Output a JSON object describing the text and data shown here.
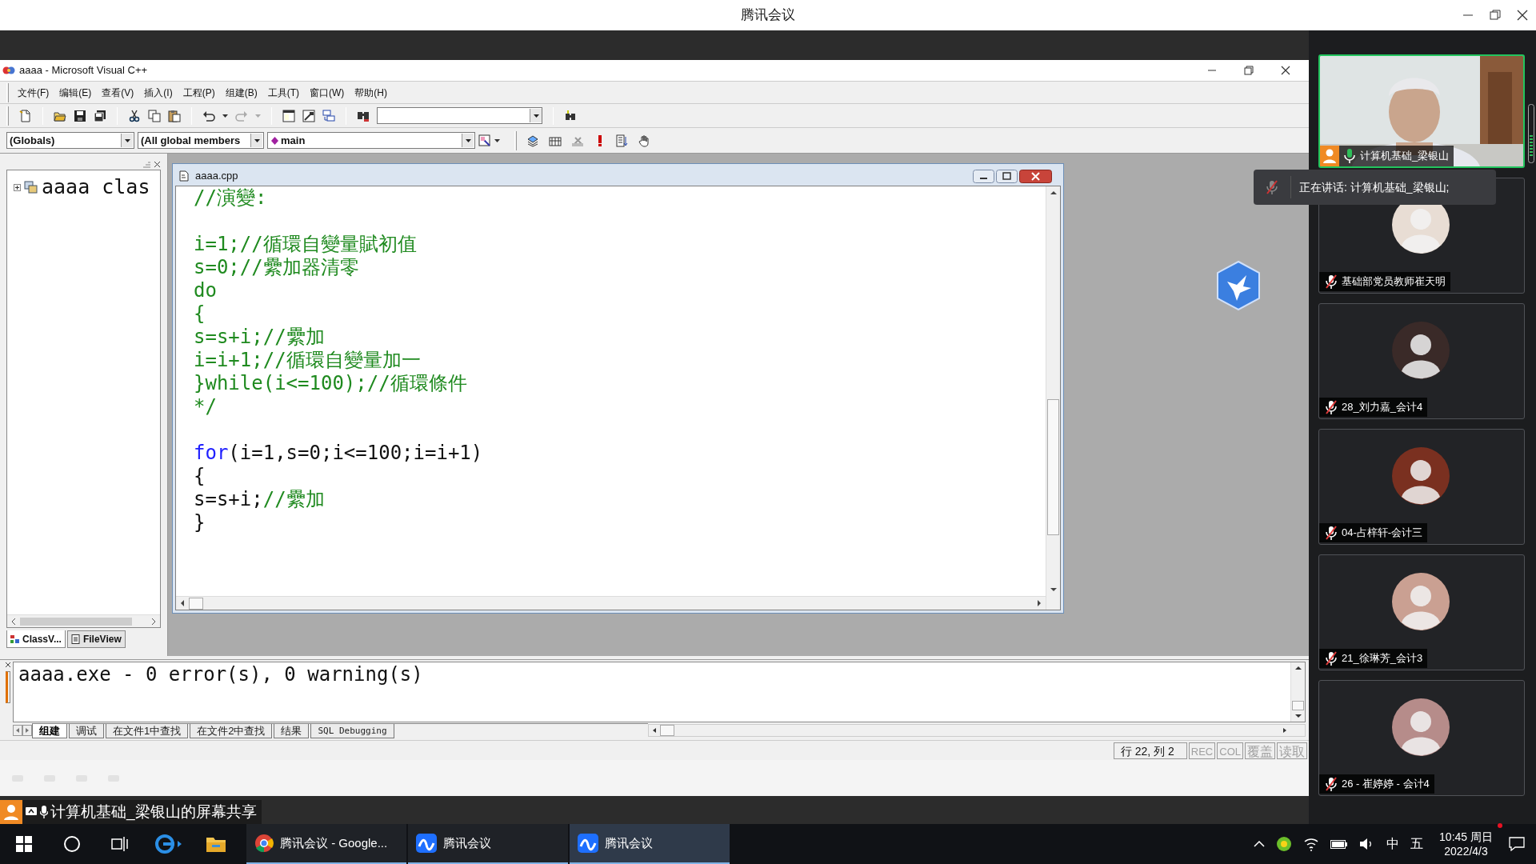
{
  "meeting_window": {
    "title": "腾讯会议"
  },
  "ide": {
    "title": "aaaa - Microsoft Visual C++",
    "menu": [
      "文件(F)",
      "编辑(E)",
      "查看(V)",
      "插入(I)",
      "工程(P)",
      "组建(B)",
      "工具(T)",
      "窗口(W)",
      "帮助(H)"
    ],
    "wizard_bar": {
      "class_combo": "(Globals)",
      "filter_combo": "(All global members",
      "function_combo": "main"
    },
    "workspace": {
      "tree": [
        {
          "label": "aaaa clas",
          "expanded": false
        }
      ],
      "tabs": [
        {
          "label": "ClassV...",
          "selected": true
        },
        {
          "label": "FileView",
          "selected": false
        }
      ]
    },
    "editor": {
      "title": "aaaa.cpp",
      "lines": [
        {
          "kind": "code",
          "segments": [
            {
              "kind": "comment",
              "text": "//演變:"
            }
          ]
        },
        {
          "kind": "blank"
        },
        {
          "kind": "code",
          "segments": [
            {
              "kind": "comment",
              "text": "i=1;//循環自變量賦初值"
            }
          ]
        },
        {
          "kind": "code",
          "segments": [
            {
              "kind": "comment",
              "text": "s=0;//纍加器清零"
            }
          ]
        },
        {
          "kind": "code",
          "segments": [
            {
              "kind": "comment",
              "text": "do"
            }
          ]
        },
        {
          "kind": "code",
          "segments": [
            {
              "kind": "comment",
              "text": "{"
            }
          ]
        },
        {
          "kind": "code",
          "segments": [
            {
              "kind": "comment",
              "text": "s=s+i;//纍加"
            }
          ]
        },
        {
          "kind": "code",
          "segments": [
            {
              "kind": "comment",
              "text": "i=i+1;//循環自變量加一"
            }
          ]
        },
        {
          "kind": "code",
          "segments": [
            {
              "kind": "comment",
              "text": "}while(i<=100);//循環條件"
            }
          ]
        },
        {
          "kind": "code",
          "segments": [
            {
              "kind": "comment",
              "text": "*/"
            }
          ]
        },
        {
          "kind": "blank"
        },
        {
          "kind": "code",
          "segments": [
            {
              "kind": "keyword",
              "text": "for"
            },
            {
              "kind": "plain",
              "text": "(i=1,s=0;i<=100;i=i+1)"
            }
          ]
        },
        {
          "kind": "code",
          "segments": [
            {
              "kind": "plain",
              "text": "{"
            }
          ]
        },
        {
          "kind": "code",
          "segments": [
            {
              "kind": "plain",
              "text": "s=s+i;"
            },
            {
              "kind": "comment",
              "text": "//纍加"
            }
          ]
        },
        {
          "kind": "code",
          "segments": [
            {
              "kind": "plain",
              "text": "}"
            }
          ]
        }
      ]
    },
    "output": {
      "lines": [
        "aaaa.exe - 0 error(s), 0 warning(s)"
      ],
      "tabs": [
        {
          "label": "组建",
          "selected": true
        },
        {
          "label": "调试",
          "selected": false
        },
        {
          "label": "在文件1中查找",
          "selected": false
        },
        {
          "label": "在文件2中查找",
          "selected": false
        },
        {
          "label": "结果",
          "selected": false
        },
        {
          "label": "SQL Debugging",
          "selected": false
        }
      ]
    },
    "status_bar": {
      "position": "行 22, 列 2",
      "indicators": [
        {
          "label": "REC",
          "disabled": true
        },
        {
          "label": "COL",
          "disabled": true
        },
        {
          "label": "覆盖",
          "disabled": true
        },
        {
          "label": "读取",
          "disabled": true
        }
      ]
    }
  },
  "participants": [
    {
      "name": "计算机基础_梁银山",
      "muted": false,
      "kind": "video"
    },
    {
      "name": "基础部党员教师崔天明",
      "muted": true,
      "kind": "avatar"
    },
    {
      "name": "28_刘力嘉_会计4",
      "muted": true,
      "kind": "avatar"
    },
    {
      "name": "04-占梓轩-会计三",
      "muted": true,
      "kind": "avatar"
    },
    {
      "name": "21_徐琳芳_会计3",
      "muted": true,
      "kind": "avatar"
    },
    {
      "name": "26 - 崔婷婷 - 会计4",
      "muted": true,
      "kind": "avatar"
    }
  ],
  "speaking_tooltip": "正在讲话: 计算机基础_梁银山;",
  "screen_share_label": "计算机基础_梁银山的屏幕共享",
  "taskbar": {
    "apps": [
      {
        "label": "腾讯会议 - Google...",
        "kind": "browser",
        "selected": false
      },
      {
        "label": "腾讯会议",
        "kind": "meeting",
        "selected": false
      },
      {
        "label": "腾讯会议",
        "kind": "meeting",
        "selected": true
      }
    ],
    "ime": [
      "中",
      "五"
    ],
    "time": "10:45 周日",
    "date": "2022/4/3"
  }
}
